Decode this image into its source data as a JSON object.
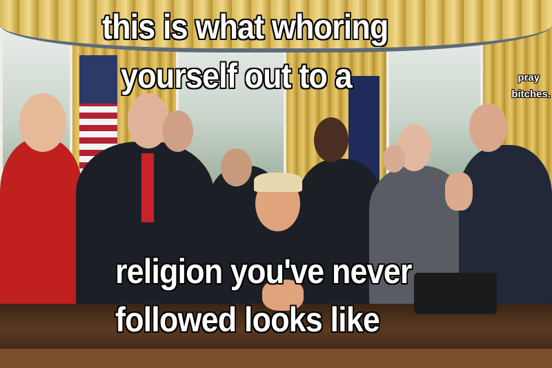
{
  "caption": {
    "top_line_1": "this is what whoring",
    "top_line_2": "yourself out to a",
    "bottom_line_1": "religion you've never",
    "bottom_line_2": "followed looks like",
    "side_line_1": "pray",
    "side_line_2": "bitches."
  },
  "colors": {
    "text": "#ffffff",
    "outline": "#000000",
    "curtain": "#d4b04f",
    "desk": "#4a2e1a",
    "red_dress": "#c0201e"
  }
}
